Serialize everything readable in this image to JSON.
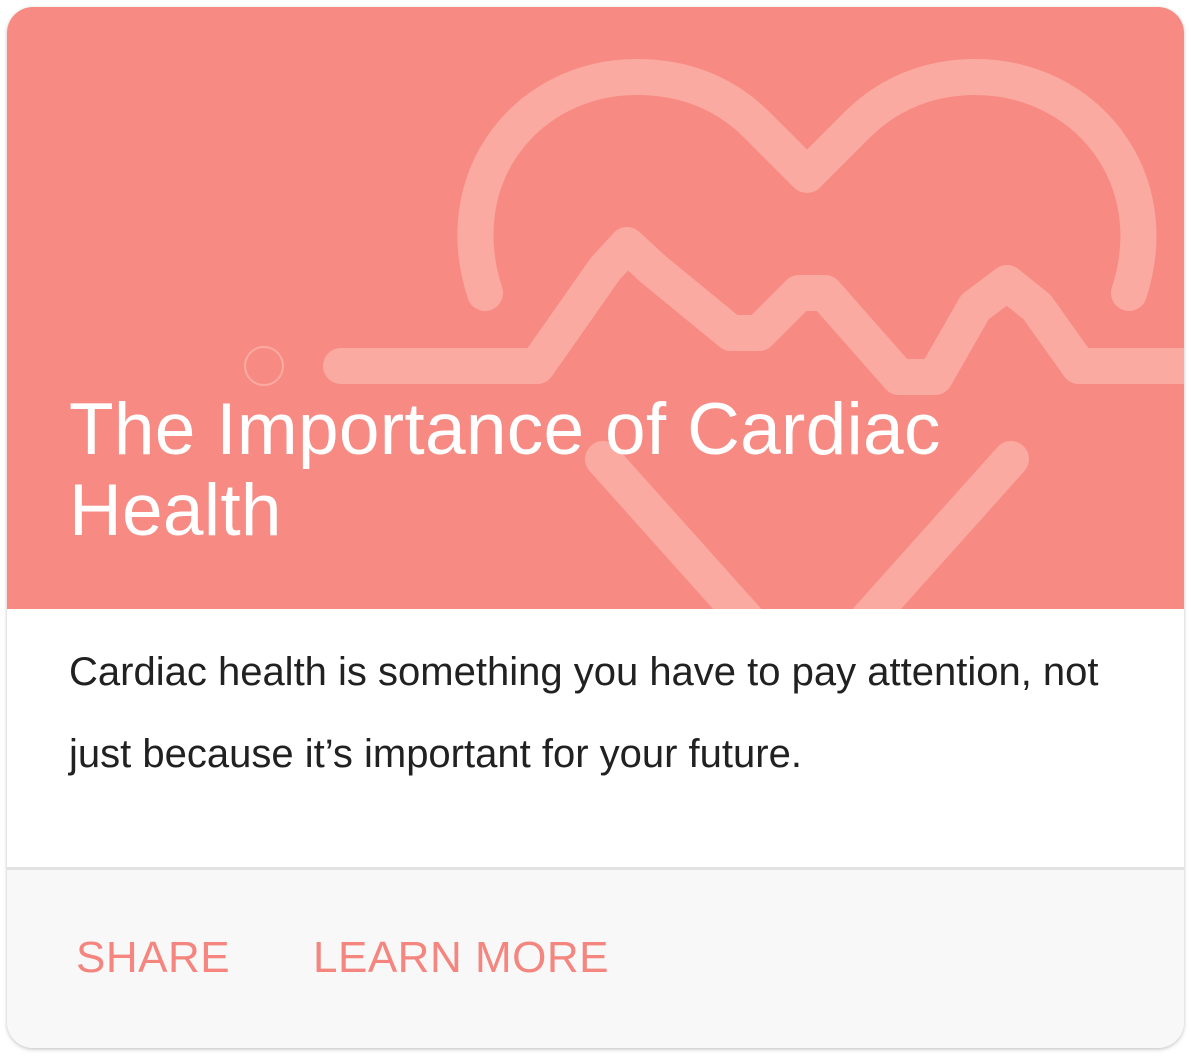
{
  "card": {
    "title": "The Importance of Cardiac Health",
    "text": "Cardiac health is something you have to pay attention, not just because it’s important for your future.",
    "actions": {
      "share_label": "SHARE",
      "learn_more_label": "LEARN MORE"
    },
    "media": {
      "icon": "heart-pulse-icon",
      "background_color": "#f78b83",
      "art_color": "#fbaaa2"
    },
    "action_color": "#f4867f"
  }
}
